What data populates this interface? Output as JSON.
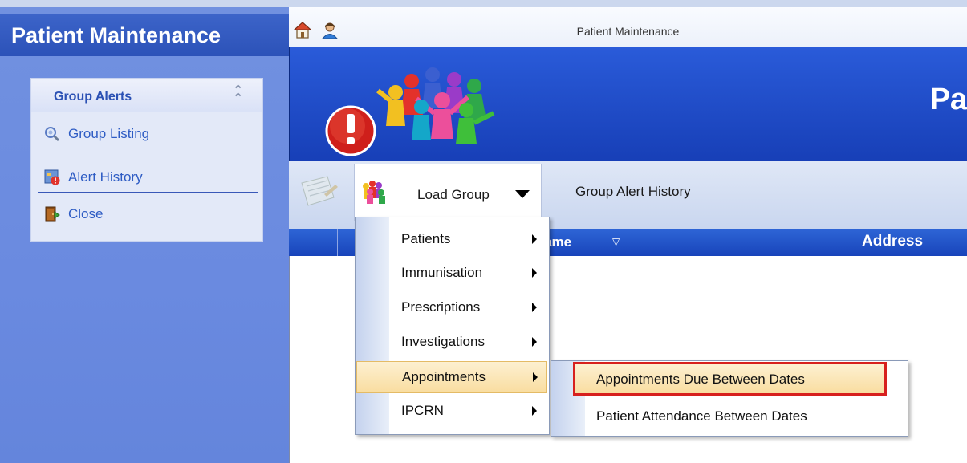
{
  "sidebar": {
    "title": "Patient Maintenance",
    "group": {
      "header": "Group Alerts",
      "items": [
        {
          "label": "Group Listing",
          "icon": "magnifier-icon"
        },
        {
          "label": "Alert History",
          "icon": "alert-history-icon"
        },
        {
          "label": "Close",
          "icon": "door-exit-icon"
        }
      ]
    }
  },
  "window": {
    "title": "Patient Maintenance",
    "banner_title": "Pa"
  },
  "toolbar": {
    "load_group": "Load Group",
    "group_alert_history": "Group Alert History"
  },
  "grid": {
    "name_header": "ame",
    "address_header": "Address"
  },
  "menu": {
    "items": [
      {
        "label": "Patients"
      },
      {
        "label": "Immunisation"
      },
      {
        "label": "Prescriptions"
      },
      {
        "label": "Investigations"
      },
      {
        "label": "Appointments"
      },
      {
        "label": "IPCRN"
      }
    ],
    "active_item": "Appointments",
    "submenu": {
      "items": [
        {
          "label": "Appointments Due Between Dates"
        },
        {
          "label": "Patient Attendance Between Dates"
        }
      ],
      "highlighted_item": "Appointments Due Between Dates"
    }
  },
  "colors": {
    "sidebar": "#6a8ae0",
    "banner": "#1f4ccc",
    "grid_header": "#2456c8",
    "menu_highlight": "#f9dda0",
    "annotation_red": "#d7201e"
  }
}
